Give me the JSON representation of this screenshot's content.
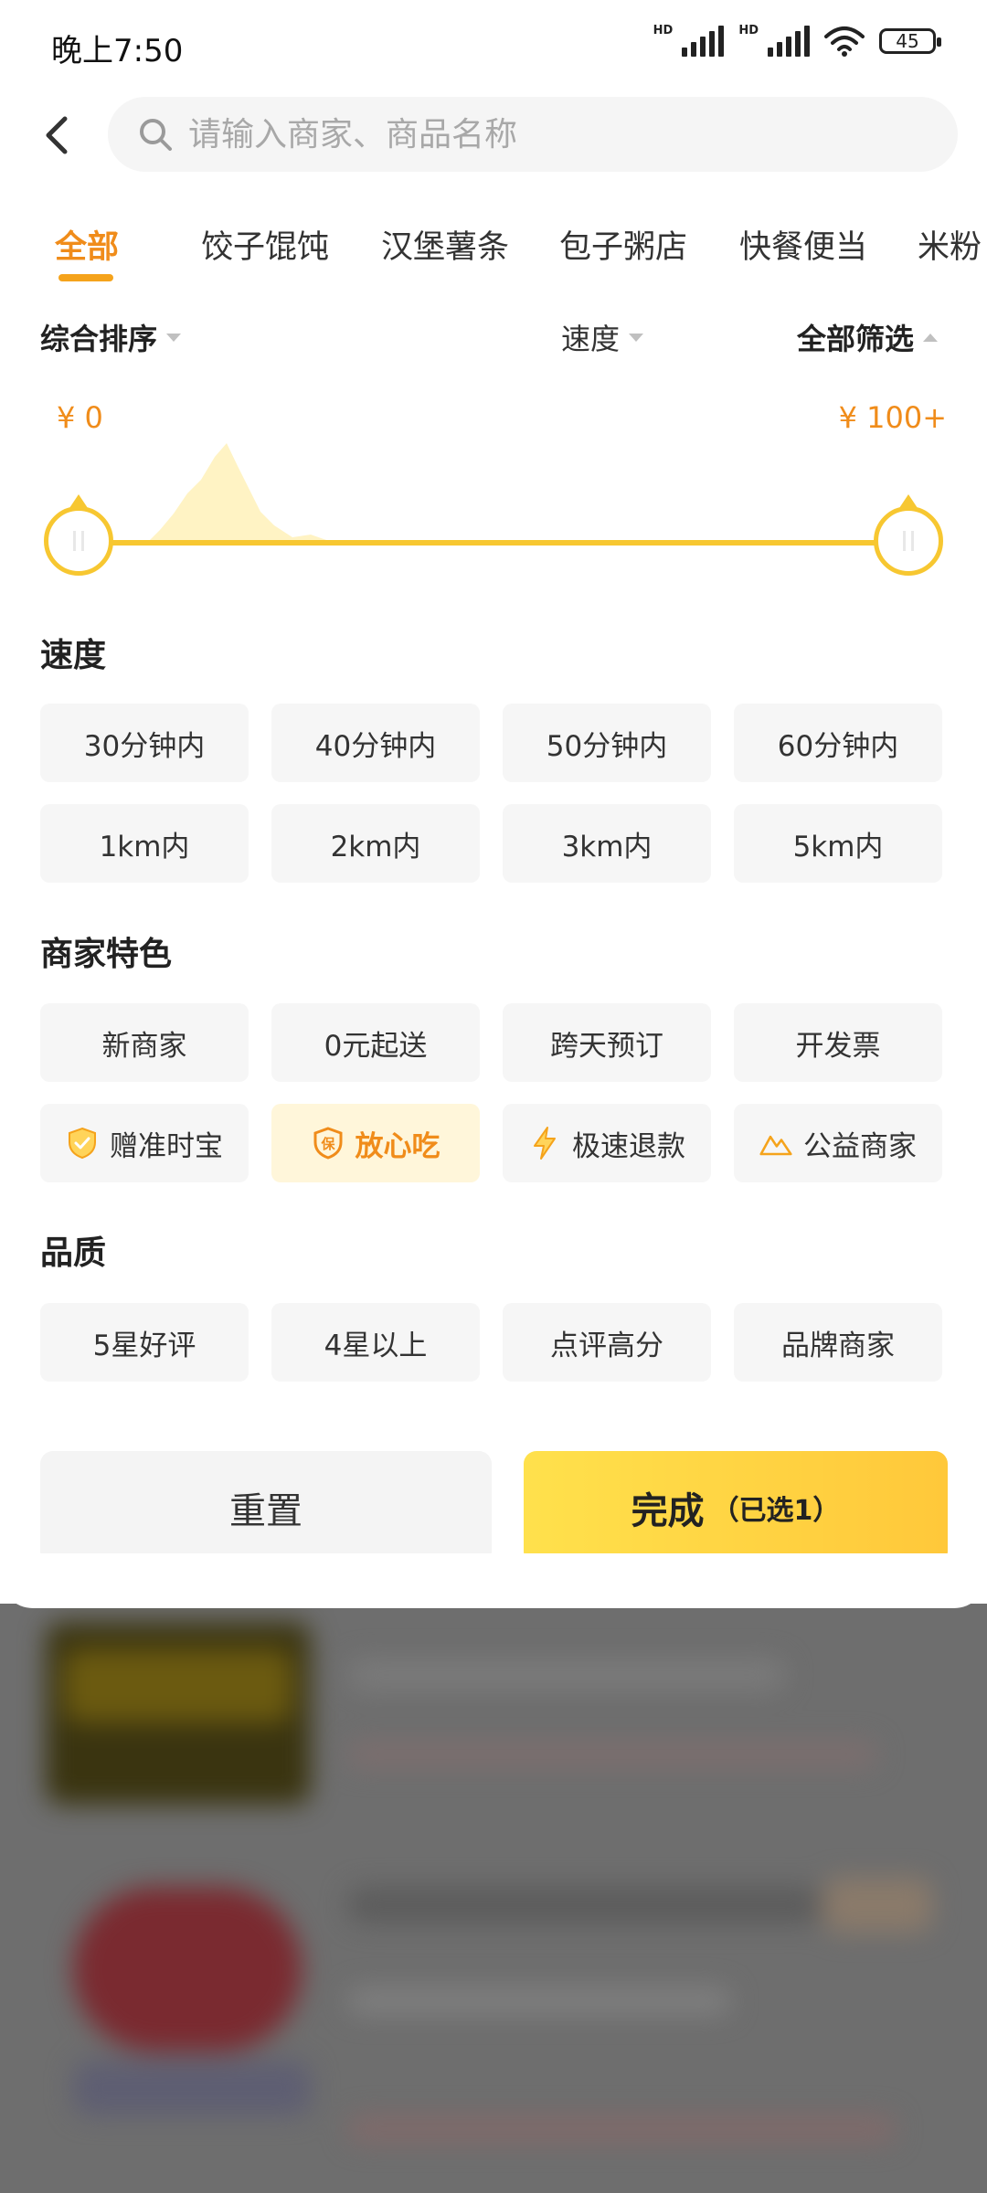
{
  "status_bar": {
    "time": "晚上7:50",
    "hd1": "HD",
    "hd2": "HD",
    "battery": "45"
  },
  "search": {
    "placeholder": "请输入商家、商品名称"
  },
  "categories": [
    "全部",
    "饺子馄饨",
    "汉堡薯条",
    "包子粥店",
    "快餐便当",
    "米粉"
  ],
  "sort": {
    "comprehensive": "综合排序",
    "speed": "速度",
    "all_filter": "全部筛选"
  },
  "price": {
    "min_label": "¥ 0",
    "max_label": "¥ 100+"
  },
  "sections": {
    "speed": {
      "title": "速度",
      "time_options": [
        "30分钟内",
        "40分钟内",
        "50分钟内",
        "60分钟内"
      ],
      "distance_options": [
        "1km内",
        "2km内",
        "3km内",
        "5km内"
      ]
    },
    "features": {
      "title": "商家特色",
      "row1": [
        "新商家",
        "0元起送",
        "跨天预订",
        "开发票"
      ],
      "row2": [
        "赠准时宝",
        "放心吃",
        "极速退款",
        "公益商家"
      ]
    },
    "quality": {
      "title": "品质",
      "options": [
        "5星好评",
        "4星以上",
        "点评高分",
        "品牌商家"
      ]
    }
  },
  "actions": {
    "reset": "重置",
    "done": "完成",
    "done_count": "（已选1）"
  },
  "colors": {
    "accent": "#f08c1a",
    "slider": "#f7c731",
    "active_chip_bg": "#fff6da"
  },
  "icons": {
    "back": "chevron-left-icon",
    "search": "search-icon",
    "shield": "shield-check-icon",
    "guarantee": "shield-bao-icon",
    "lightning": "lightning-icon",
    "mountain": "mountain-icon"
  }
}
